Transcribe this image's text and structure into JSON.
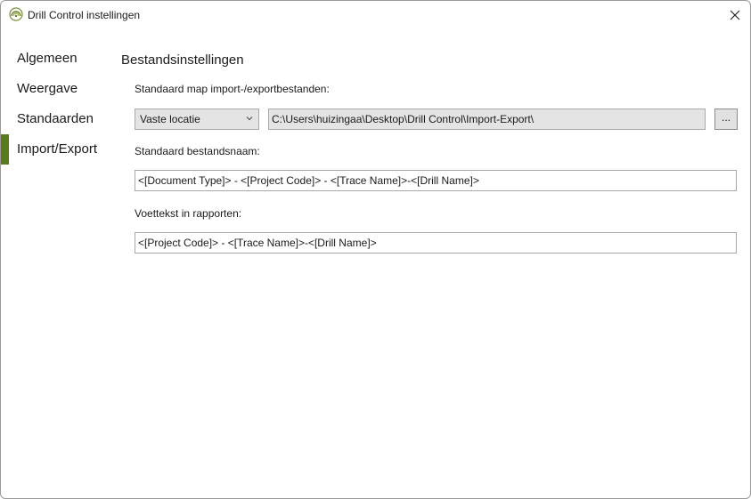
{
  "window": {
    "title": "Drill Control instellingen"
  },
  "sidebar": {
    "items": [
      {
        "label": "Algemeen"
      },
      {
        "label": "Weergave"
      },
      {
        "label": "Standaarden"
      },
      {
        "label": "Import/Export",
        "active": true
      }
    ]
  },
  "main": {
    "section_title": "Bestandsinstellingen",
    "folder_label": "Standaard map import-/exportbestanden:",
    "location_mode": "Vaste locatie",
    "folder_path": "C:\\Users\\huizingaa\\Desktop\\Drill Control\\Import-Export\\",
    "browse_label": "...",
    "filename_label": "Standaard bestandsnaam:",
    "filename_value": "<[Document Type]> - <[Project Code]> - <[Trace Name]>-<[Drill Name]>",
    "footer_label": "Voettekst in rapporten:",
    "footer_value": "<[Project Code]> - <[Trace Name]>-<[Drill Name]>"
  },
  "colors": {
    "accent": "#5a7a1f"
  },
  "icons": {
    "app": "drill-control-logo-icon",
    "close": "close-icon",
    "dropdown": "chevron-down-icon"
  }
}
